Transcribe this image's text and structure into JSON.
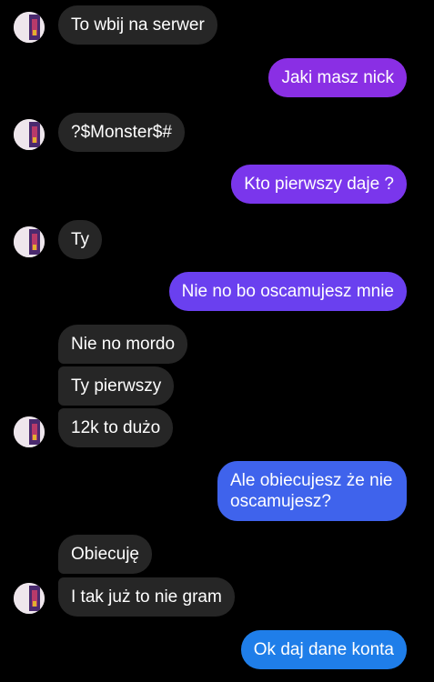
{
  "theme": {
    "background": "#000000",
    "incoming_bubble": "#262626",
    "text": "#ffffff",
    "outgoing_gradient": [
      "#8e2ee0",
      "#5a4af0",
      "#2a75ea",
      "#1a86ea"
    ]
  },
  "messages": [
    {
      "side": "in",
      "text": "To wbij na serwer"
    },
    {
      "side": "out",
      "text": "Jaki masz nick"
    },
    {
      "side": "in",
      "text": "?$Monster$#"
    },
    {
      "side": "out",
      "text": "Kto pierwszy daje ?"
    },
    {
      "side": "in",
      "text": "Ty"
    },
    {
      "side": "out",
      "text": "Nie no bo oscamujesz mnie"
    },
    {
      "side": "in",
      "text": "Nie no mordo"
    },
    {
      "side": "in",
      "text": "Ty pierwszy"
    },
    {
      "side": "in",
      "text": "12k to dużo"
    },
    {
      "side": "out",
      "text": "Ale obiecujesz że nie oscamujesz?"
    },
    {
      "side": "in",
      "text": "Obiecuję"
    },
    {
      "side": "in",
      "text": "I tak już to nie gram"
    },
    {
      "side": "out",
      "text": "Ok daj dane konta"
    }
  ]
}
